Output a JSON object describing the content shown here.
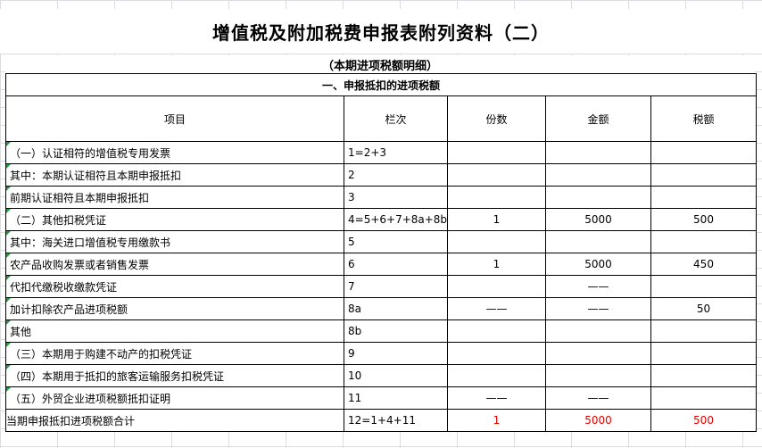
{
  "title": "增值税及附加税费申报表附列资料（二）",
  "subtitle": "（本期进项税额明细）",
  "section": "一、申报抵扣的进项税额",
  "headers": {
    "item": "项目",
    "column": "栏次",
    "count": "份数",
    "amount": "金额",
    "tax": "税额"
  },
  "rows": [
    {
      "label": "（一）认证相符的增值税专用发票",
      "col": "1=2+3",
      "count": "",
      "amount": "",
      "tax": ""
    },
    {
      "label": "其中：本期认证相符且本期申报抵扣",
      "col": "2",
      "count": "",
      "amount": "",
      "tax": ""
    },
    {
      "label": "前期认证相符且本期申报抵扣",
      "col": "3",
      "count": "",
      "amount": "",
      "tax": ""
    },
    {
      "label": "（二）其他扣税凭证",
      "col": "4=5+6+7+8a+8b",
      "count": "1",
      "amount": "5000",
      "tax": "500"
    },
    {
      "label": "其中：海关进口增值税专用缴款书",
      "col": "5",
      "count": "",
      "amount": "",
      "tax": ""
    },
    {
      "label": "农产品收购发票或者销售发票",
      "col": "6",
      "count": "1",
      "amount": "5000",
      "tax": "450"
    },
    {
      "label": "代扣代缴税收缴款凭证",
      "col": "7",
      "count": "",
      "amount": "——",
      "tax": ""
    },
    {
      "label": "加计扣除农产品进项税额",
      "col": "8a",
      "count": "——",
      "amount": "——",
      "tax": "50"
    },
    {
      "label": "其他",
      "col": "8b",
      "count": "",
      "amount": "",
      "tax": ""
    },
    {
      "label": "（三）本期用于购建不动产的扣税凭证",
      "col": "9",
      "count": "",
      "amount": "",
      "tax": ""
    },
    {
      "label": "（四）本期用于抵扣的旅客运输服务扣税凭证",
      "col": "10",
      "count": "",
      "amount": "",
      "tax": ""
    },
    {
      "label": "（五）外贸企业进项税额抵扣证明",
      "col": "11",
      "count": "——",
      "amount": "——",
      "tax": ""
    },
    {
      "label": "当期申报抵扣进项税额合计",
      "col": "12=1+4+11",
      "count": "1",
      "amount": "5000",
      "tax": "500"
    }
  ],
  "colors": {
    "grid": "#dadcdf",
    "border": "#000000",
    "highlight": "#e00000",
    "cell_marker": "#1f9f3a"
  }
}
